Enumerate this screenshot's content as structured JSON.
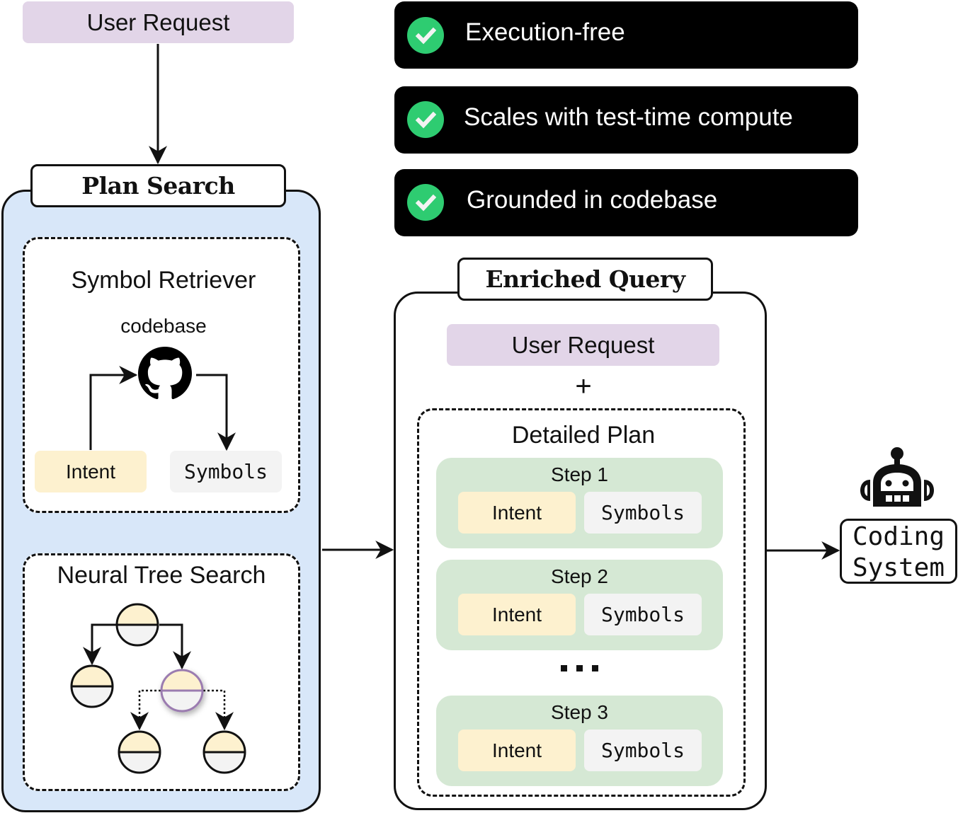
{
  "top_request": {
    "label": "User Request",
    "color": "#e2d5e8"
  },
  "plan_search": {
    "title": "Plan Search",
    "panel_color": "#d8e7f9",
    "symbol_retriever": {
      "title": "Symbol Retriever",
      "codebase_label": "codebase",
      "codebase_icon": "github-icon",
      "intent_label": "Intent",
      "symbols_label": "Symbols"
    },
    "neural_tree_search": {
      "title": "Neural Tree Search",
      "node_colors": {
        "top": "#fdf1cf",
        "bottom": "#f3f3f3",
        "highlight_stroke": "#9b7bb0"
      },
      "nodes": [
        "root",
        "left-child",
        "right-child-selected",
        "grandchild-left",
        "grandchild-right"
      ]
    }
  },
  "features": [
    {
      "icon": "check-circle-icon",
      "label": "Execution-free"
    },
    {
      "icon": "check-circle-icon",
      "label": "Scales with test-time compute"
    },
    {
      "icon": "check-circle-icon",
      "label": "Grounded in codebase"
    }
  ],
  "feature_check_color": "#2ecc71",
  "enriched_query": {
    "title": "Enriched Query",
    "user_request_label": "User Request",
    "plus": "+",
    "detailed_plan": {
      "title": "Detailed Plan",
      "step_color": "#d5e8d4",
      "steps": [
        {
          "label": "Step 1",
          "intent": "Intent",
          "symbols": "Symbols"
        },
        {
          "label": "Step 2",
          "intent": "Intent",
          "symbols": "Symbols"
        },
        {
          "label": "Step 3",
          "intent": "Intent",
          "symbols": "Symbols"
        }
      ],
      "ellipsis": "..."
    }
  },
  "coding_system": {
    "icon": "robot-icon",
    "line1": "Coding",
    "line2": "System"
  }
}
